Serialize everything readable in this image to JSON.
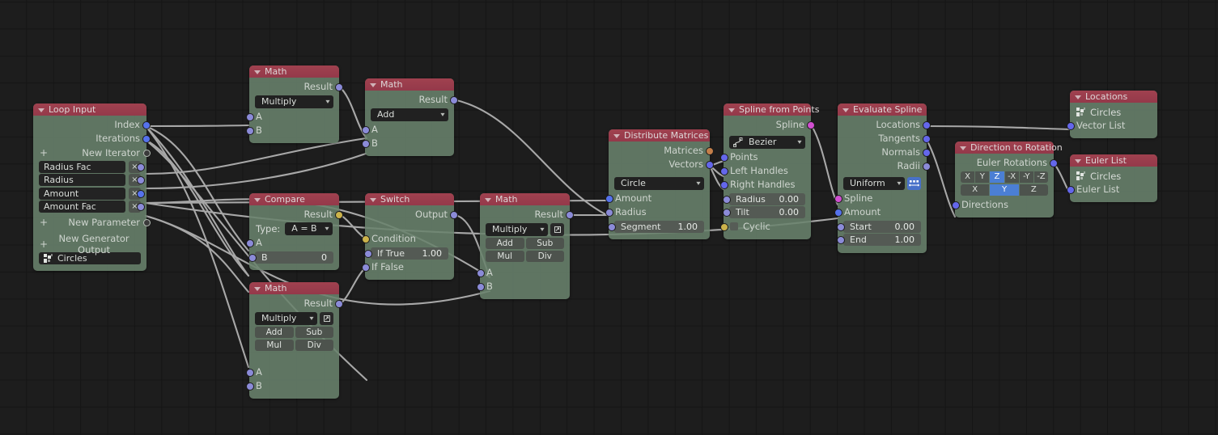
{
  "editor": {
    "name": "blender-node-editor",
    "background": "#1d1d1d",
    "grid_color": "#151515",
    "wire_color": "#a8a8a8",
    "header_color": "#98394a",
    "body_color": "#69826c"
  },
  "nodes": {
    "loop_input": {
      "title": "Loop Input",
      "outputs": [
        "Index",
        "Iterations"
      ],
      "new_iterator": "New Iterator",
      "params": [
        "Radius Fac",
        "Radius",
        "Amount",
        "Amount Fac"
      ],
      "close_label": "×",
      "new_parameter": "New Parameter",
      "new_generator_output": "New Generator Output",
      "generator": "Circles",
      "plus": "+"
    },
    "math_multiply_top": {
      "title": "Math",
      "output": "Result",
      "operation": "Multiply",
      "inputs": [
        "A",
        "B"
      ]
    },
    "math_add": {
      "title": "Math",
      "output": "Result",
      "operation": "Add",
      "inputs": [
        "A",
        "B"
      ]
    },
    "compare": {
      "title": "Compare",
      "output": "Result",
      "type_label": "Type:",
      "type_value": "A = B",
      "input_a": "A",
      "input_b_label": "B",
      "input_b_value": "0"
    },
    "switch": {
      "title": "Switch",
      "output": "Output",
      "condition": "Condition",
      "if_true_label": "If True",
      "if_true_value": "1.00",
      "if_false": "If False"
    },
    "math_multiply_mid": {
      "title": "Math",
      "output": "Result",
      "operation": "Multiply",
      "buttons": [
        "Add",
        "Sub",
        "Mul",
        "Div"
      ],
      "inputs": [
        "A",
        "B"
      ]
    },
    "math_multiply_bottom": {
      "title": "Math",
      "output": "Result",
      "operation": "Multiply",
      "buttons": [
        "Add",
        "Sub",
        "Mul",
        "Div"
      ],
      "inputs": [
        "A",
        "B"
      ]
    },
    "distribute_matrices": {
      "title": "Distribute Matrices",
      "outputs": [
        "Matrices",
        "Vectors"
      ],
      "mode": "Circle",
      "inputs": [
        "Amount",
        "Radius"
      ],
      "segment_label": "Segment",
      "segment_value": "1.00"
    },
    "spline_from_points": {
      "title": "Spline from Points",
      "output": "Spline",
      "spline_type": "Bezier",
      "inputs": [
        "Points",
        "Left Handles",
        "Right Handles"
      ],
      "radius_label": "Radius",
      "radius_value": "0.00",
      "tilt_label": "Tilt",
      "tilt_value": "0.00",
      "cyclic": "Cyclic"
    },
    "evaluate_spline": {
      "title": "Evaluate Spline",
      "outputs": [
        "Locations",
        "Tangents",
        "Normals",
        "Radii"
      ],
      "mode": "Uniform",
      "inputs": [
        "Spline",
        "Amount"
      ],
      "start_label": "Start",
      "start_value": "0.00",
      "end_label": "End",
      "end_value": "1.00"
    },
    "direction_to_rotation": {
      "title": "Direction to Rotation",
      "output": "Euler Rotations",
      "axis_row_1": [
        "X",
        "Y",
        "Z",
        "-X",
        "-Y",
        "-Z"
      ],
      "axis_row_1_selected": "Z",
      "axis_row_2": [
        "X",
        "Y",
        "Z"
      ],
      "axis_row_2_selected": "Y",
      "input": "Directions"
    },
    "locations": {
      "title": "Locations",
      "generator": "Circles",
      "input": "Vector List"
    },
    "euler_list": {
      "title": "Euler List",
      "generator": "Circles",
      "input": "Euler List"
    }
  }
}
